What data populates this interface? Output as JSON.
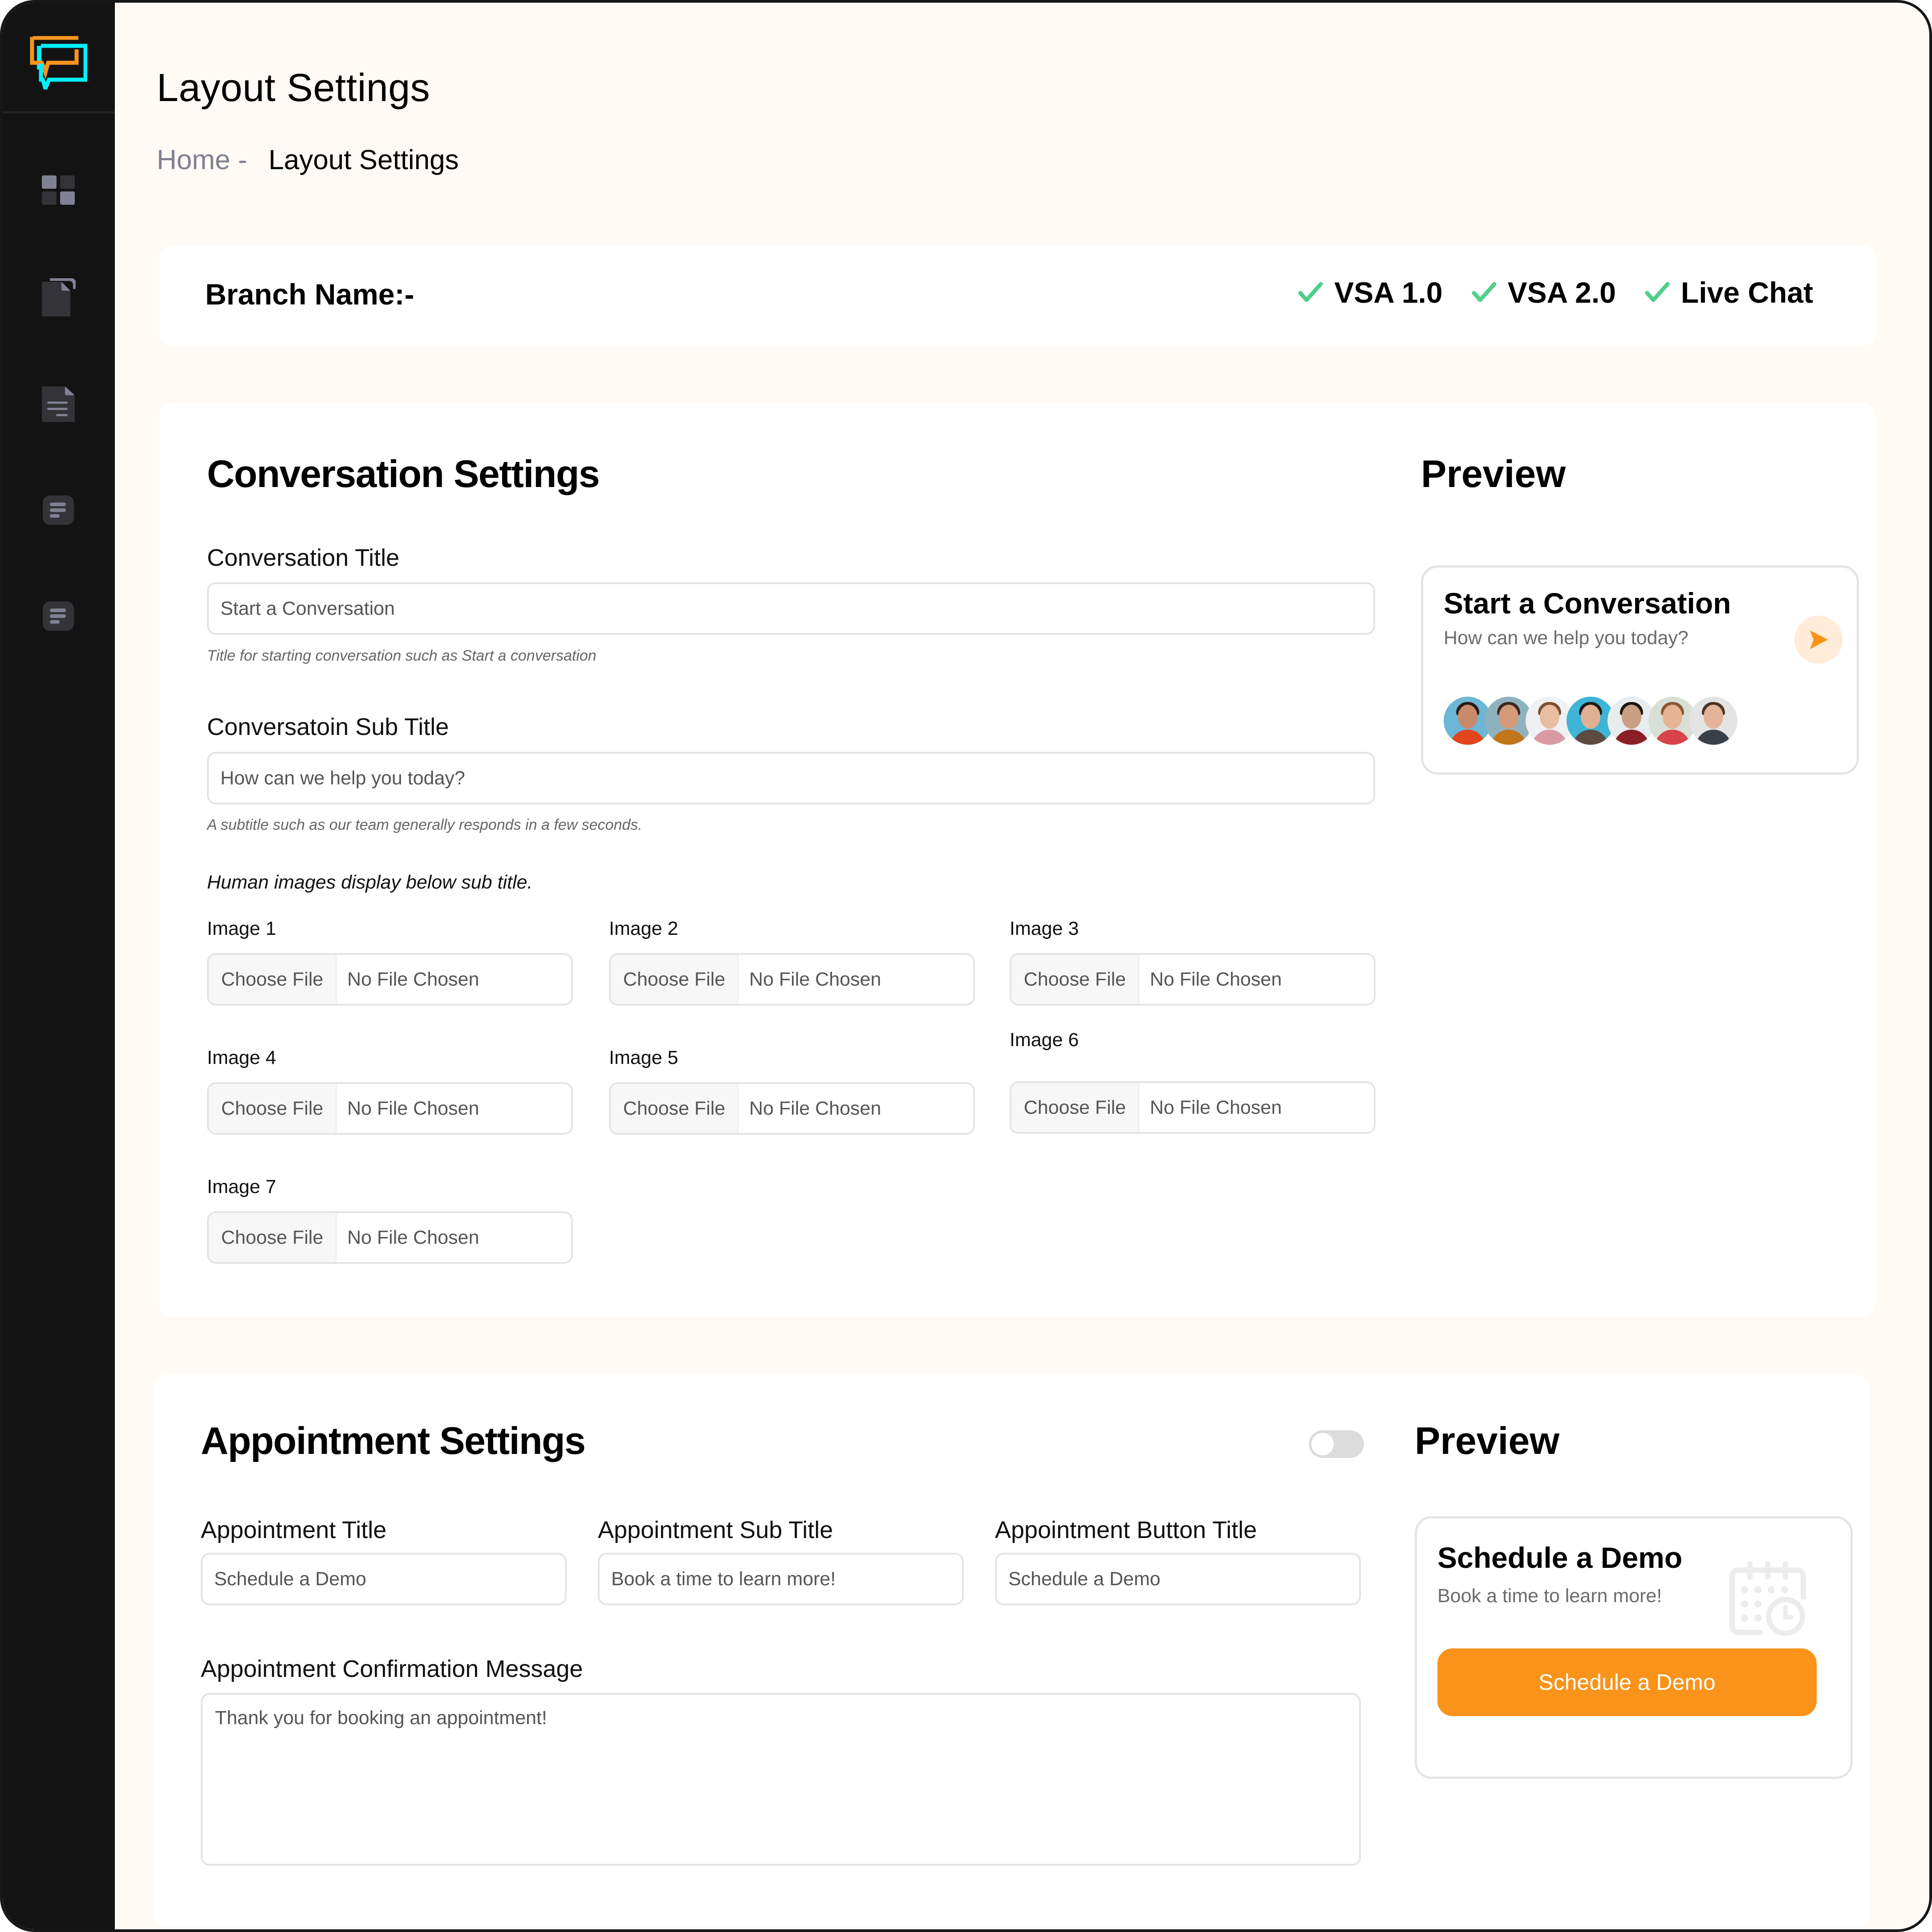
{
  "sidebar": {
    "logo": "chat-bubbles-logo",
    "items": [
      {
        "icon": "dashboard-grid-icon"
      },
      {
        "icon": "documents-copy-icon"
      },
      {
        "icon": "document-text-icon"
      },
      {
        "icon": "list-card-icon"
      },
      {
        "icon": "list-card-icon"
      }
    ]
  },
  "header": {
    "title": "Layout Settings",
    "breadcrumb": {
      "home": "Home -",
      "current": "Layout Settings"
    }
  },
  "branch": {
    "label": "Branch Name:-",
    "products": [
      {
        "label": "VSA 1.0",
        "checked": true
      },
      {
        "label": "VSA 2.0",
        "checked": true
      },
      {
        "label": "Live Chat",
        "checked": true
      }
    ],
    "check_color": "#4fcf8a"
  },
  "conversation": {
    "title": "Conversation Settings",
    "preview_title": "Preview",
    "title_field": {
      "label": "Conversation Title",
      "value": "Start a Conversation",
      "hint": "Title for starting conversation such as Start a conversation"
    },
    "subtitle_field": {
      "label": "Conversatoin Sub Title",
      "value": "How can we help you today?",
      "hint": "A subtitle such as our team generally responds in a few seconds."
    },
    "images_note": "Human images display below sub title.",
    "images": [
      {
        "label": "Image 1",
        "button": "Choose File",
        "status": "No File Chosen"
      },
      {
        "label": "Image 2",
        "button": "Choose File",
        "status": "No File Chosen"
      },
      {
        "label": "Image 3",
        "button": "Choose File",
        "status": "No File Chosen"
      },
      {
        "label": "Image 4",
        "button": "Choose File",
        "status": "No File Chosen"
      },
      {
        "label": "Image 5",
        "button": "Choose File",
        "status": "No File Chosen"
      },
      {
        "label": "Image 6",
        "button": "Choose File",
        "status": "No File Chosen"
      },
      {
        "label": "Image 7",
        "button": "Choose File",
        "status": "No File Chosen"
      }
    ],
    "preview": {
      "title": "Start a Conversation",
      "subtitle": "How can we help you today?",
      "send_icon": "send-arrow-icon",
      "avatar_count": 7
    }
  },
  "appointment": {
    "title": "Appointment Settings",
    "enabled": false,
    "preview_title": "Preview",
    "fields": [
      {
        "label": "Appointment Title",
        "value": "Schedule a Demo"
      },
      {
        "label": "Appointment Sub Title",
        "value": "Book a time to learn more!"
      },
      {
        "label": "Appointment Button Title",
        "value": "Schedule a Demo"
      }
    ],
    "confirmation": {
      "label": "Appointment Confirmation Message",
      "value": "Thank you for booking an appointment!"
    },
    "preview": {
      "title": "Schedule a Demo",
      "subtitle": "Book a time to learn more!",
      "button": "Schedule a Demo",
      "icon": "calendar-clock-icon"
    }
  },
  "colors": {
    "accent": "#f99319",
    "sidebar_bg": "#131313",
    "page_bg": "#fffaf6",
    "breadcrumb_muted": "#7f8091",
    "logo_orange": "#f7941d",
    "logo_cyan": "#00f0ff"
  }
}
